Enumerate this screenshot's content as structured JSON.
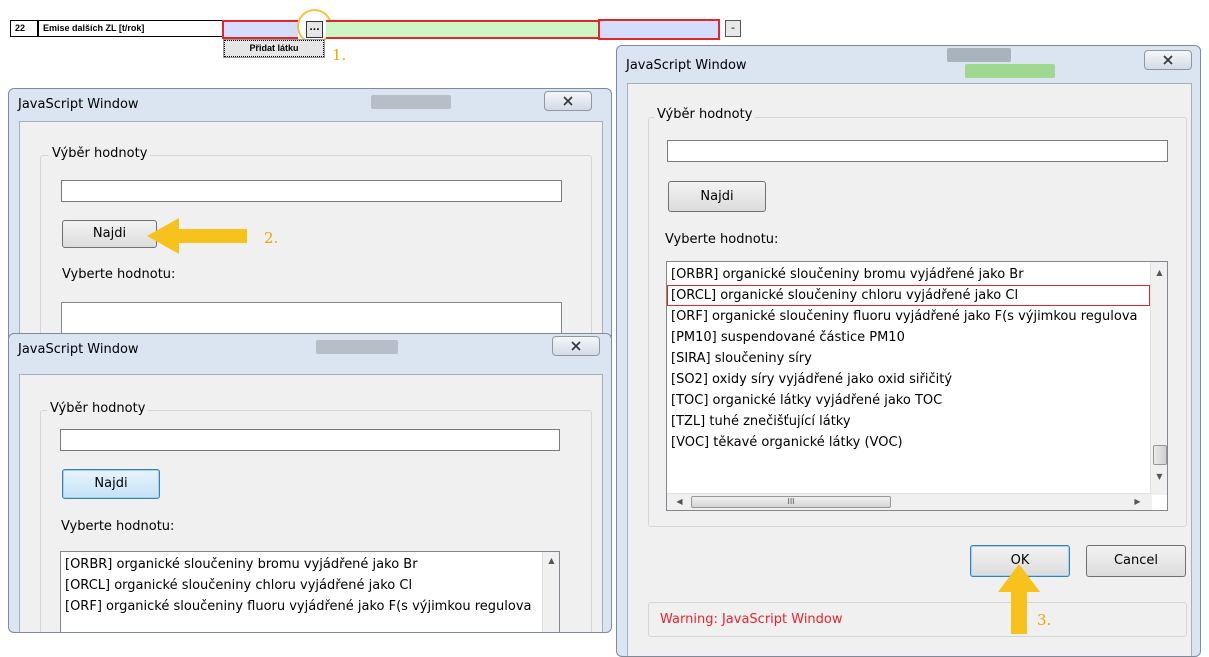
{
  "form_row": {
    "number": "22",
    "label": "Emise dalších ZL [t/rok]",
    "dots_button": "...",
    "dash_button": "-",
    "add_button": "Přidat látku"
  },
  "steps": {
    "one": "1.",
    "two": "2.",
    "three": "3."
  },
  "colors": {
    "accent_arrow": "#f7c21b",
    "highlight_red": "#e5252d",
    "field_blue": "#d4ddfb",
    "field_green": "#ccf7c5"
  },
  "icons": {
    "close": "close-x-icon",
    "arrow": "yellow-arrow-icon"
  },
  "window_left_top": {
    "title": "JavaScript Window",
    "close_label": "☒",
    "legend": "Výběr hodnoty",
    "search_value": "",
    "find_button": "Najdi",
    "choose_label": "Vyberte hodnotu:"
  },
  "window_left_bottom": {
    "title": "JavaScript Window",
    "close_label": "☒",
    "legend": "Výběr hodnoty",
    "search_value": "",
    "find_button": "Najdi",
    "choose_label": "Vyberte hodnotu:",
    "items": [
      "[ORBR] organické sloučeniny bromu vyjádřené jako Br",
      "[ORCL] organické sloučeniny chloru vyjádřené jako Cl",
      "[ORF] organické sloučeniny fluoru vyjádřené jako F(s výjimkou regulova"
    ]
  },
  "window_right": {
    "title": "JavaScript Window",
    "close_label": "☒",
    "legend": "Výběr hodnoty",
    "search_value": "",
    "find_button": "Najdi",
    "choose_label": "Vyberte hodnotu:",
    "items": [
      "[ORBR] organické sloučeniny bromu vyjádřené jako Br",
      "[ORCL] organické sloučeniny chloru vyjádřené jako Cl",
      "[ORF] organické sloučeniny fluoru vyjádřené jako F(s výjimkou regulova",
      "[PM10] suspendované částice PM10",
      "[SIRA] sloučeniny síry",
      "[SO2] oxidy síry vyjádřené jako oxid siřičitý",
      "[TOC] organické látky vyjádřené jako TOC",
      "[TZL] tuhé znečišťující látky",
      "[VOC] těkavé organické látky (VOC)"
    ],
    "selected_index": 1,
    "hscroll_grip": "III",
    "ok_button": "OK",
    "cancel_button": "Cancel",
    "warning": "Warning: JavaScript Window"
  }
}
